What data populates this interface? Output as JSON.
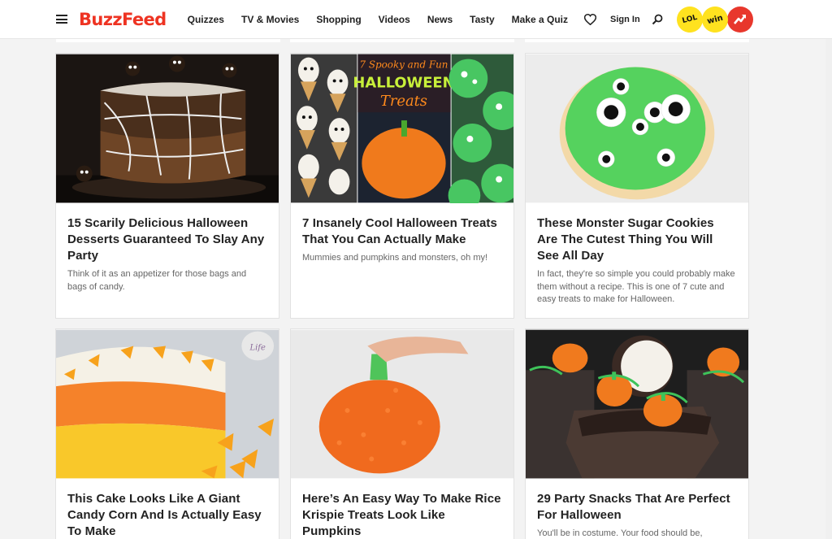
{
  "header": {
    "logo": "BuzzFeed",
    "nav": [
      "Quizzes",
      "TV & Movies",
      "Shopping",
      "Videos",
      "News",
      "Tasty",
      "Make a Quiz"
    ],
    "sign_in": "Sign In",
    "badges": {
      "lol": "LOL",
      "win": "win"
    }
  },
  "cards": [
    {
      "title": "15 Scarily Delicious Halloween Desserts Guaranteed To Slay Any Party",
      "description": "Think of it as an appetizer for those bags and bags of candy."
    },
    {
      "title": "7 Insanely Cool Halloween Treats That You Can Actually Make",
      "description": "Mummies and pumpkins and monsters, oh my!",
      "image_text": [
        "7 Spooky and Fun",
        "HALLOWEEN",
        "Treats"
      ]
    },
    {
      "title": "These Monster Sugar Cookies Are The Cutest Thing You Will See All Day",
      "description": "In fact, they're so simple you could probably make them without a recipe. This is one of 7 cute and easy treats to make for Halloween."
    },
    {
      "title": "This Cake Looks Like A Giant Candy Corn And Is Actually Easy To Make",
      "description": "",
      "image_watermark": "Life"
    },
    {
      "title": "Here’s An Easy Way To Make Rice Krispie Treats Look Like Pumpkins",
      "description": ""
    },
    {
      "title": "29 Party Snacks That Are Perfect For Halloween",
      "description": "You'll be in costume. Your food should be,"
    }
  ],
  "colors": {
    "brand": "#ee3322",
    "badge_yellow": "#ffe21f",
    "badge_red": "#e8372c"
  }
}
